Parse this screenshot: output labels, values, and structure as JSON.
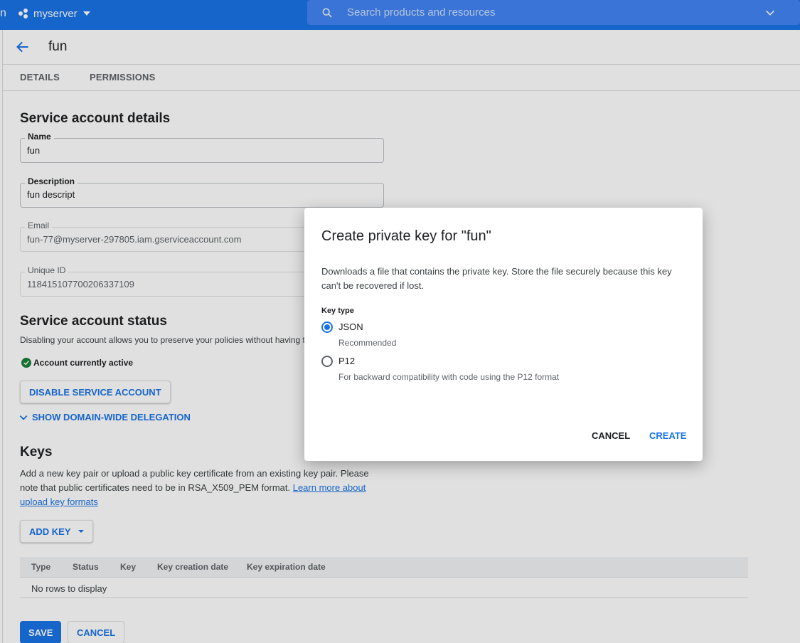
{
  "topbar": {
    "edge_text": "n",
    "project_name": "myserver",
    "search_placeholder": "Search products and resources"
  },
  "page": {
    "title": "fun",
    "tabs": [
      "DETAILS",
      "PERMISSIONS"
    ]
  },
  "details": {
    "heading": "Service account details",
    "name_label": "Name",
    "name_value": "fun",
    "description_label": "Description",
    "description_value": "fun descript",
    "email_label": "Email",
    "email_value": "fun-77@myserver-297805.iam.gserviceaccount.com",
    "unique_id_label": "Unique ID",
    "unique_id_value": "118415107700206337109"
  },
  "status": {
    "heading": "Service account status",
    "description": "Disabling your account allows you to preserve your policies without having t",
    "active_text": "Account currently active",
    "disable_button": "DISABLE SERVICE ACCOUNT",
    "delegation_link": "SHOW DOMAIN-WIDE DELEGATION"
  },
  "keys": {
    "heading": "Keys",
    "desc_part1": "Add a new key pair or upload a public key certificate from an existing key pair. Please note that public certificates need to be in RSA_X509_PEM format. ",
    "desc_link": "Learn more about upload key formats",
    "add_key_button": "ADD KEY",
    "table_headers": [
      "Type",
      "Status",
      "Key",
      "Key creation date",
      "Key expiration date"
    ],
    "empty_text": "No rows to display"
  },
  "footer": {
    "save": "SAVE",
    "cancel": "CANCEL"
  },
  "dialog": {
    "title": "Create private key for \"fun\"",
    "description": "Downloads a file that contains the private key. Store the file securely because this key can't be recovered if lost.",
    "key_type_label": "Key type",
    "options": [
      {
        "label": "JSON",
        "sub": "Recommended",
        "selected": true
      },
      {
        "label": "P12",
        "sub": "For backward compatibility with code using the P12 format",
        "selected": false
      }
    ],
    "cancel": "CANCEL",
    "create": "CREATE"
  },
  "colors": {
    "brand_blue": "#1a73e8",
    "active_green": "#188038"
  }
}
